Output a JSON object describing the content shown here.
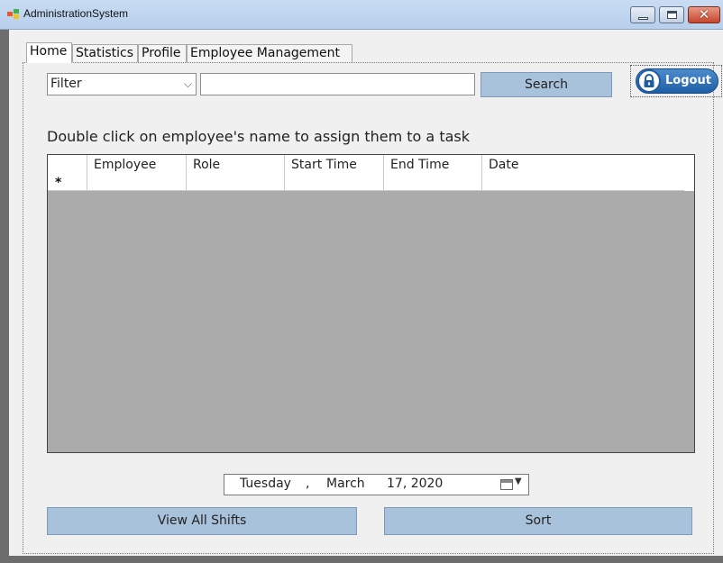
{
  "window": {
    "title": "AdministrationSystem"
  },
  "tabs": [
    {
      "label": "Home",
      "active": true
    },
    {
      "label": "Statistics"
    },
    {
      "label": "Profile"
    },
    {
      "label": "Employee Management"
    }
  ],
  "toolbar": {
    "filter_value": "Filter",
    "search_value": "",
    "search_label": "Search",
    "logout_label": "Logout"
  },
  "instruction": "Double click on employee's name to assign them to a task",
  "grid": {
    "columns": [
      "Employee",
      "Role",
      "Start Time",
      "End Time",
      "Date"
    ],
    "new_row_marker": "*",
    "background": "#ababab"
  },
  "date_picker": {
    "weekday": "Tuesday",
    "sep": ",",
    "month": "March",
    "day_year": "17, 2020"
  },
  "actions": {
    "view_all_label": "View All Shifts",
    "sort_label": "Sort"
  },
  "colors": {
    "button": "#a9c2dc",
    "logout": "#1f5ea6",
    "titlebar": "#c9dcf2"
  }
}
